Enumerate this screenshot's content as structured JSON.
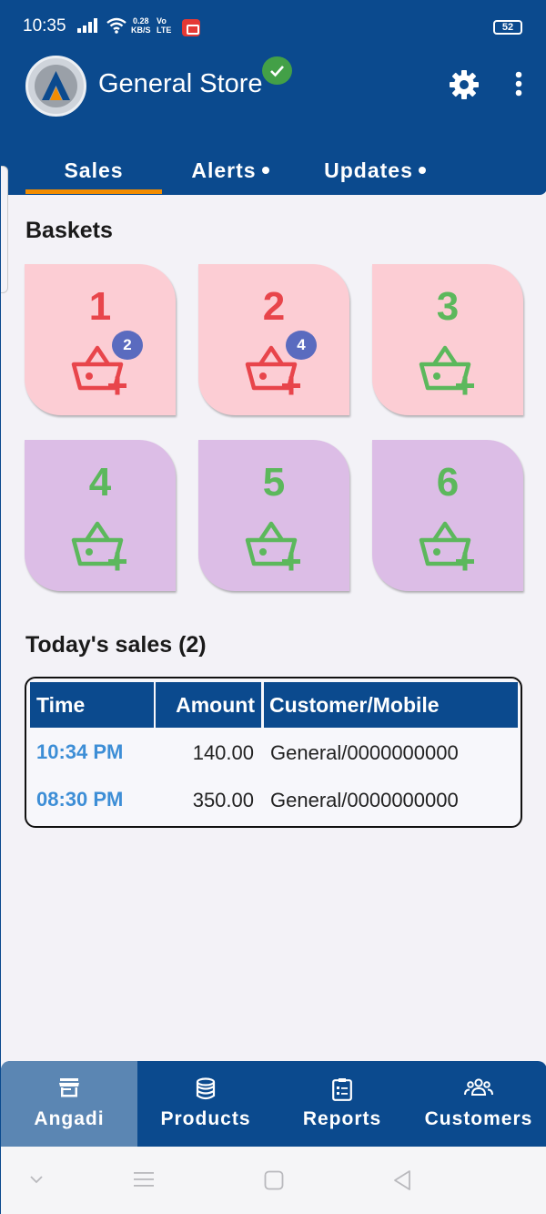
{
  "status": {
    "time": "10:35",
    "net_speed_value": "0.28",
    "net_speed_unit": "KB/S",
    "volte_top": "Vo",
    "volte_bottom": "LTE",
    "battery": "52"
  },
  "header": {
    "store_name": "General Store"
  },
  "tabs": [
    {
      "label": "Sales",
      "active": true,
      "has_dot": false
    },
    {
      "label": "Alerts",
      "active": false,
      "has_dot": true
    },
    {
      "label": "Updates",
      "active": false,
      "has_dot": true
    }
  ],
  "baskets": {
    "title": "Baskets",
    "items": [
      {
        "number": "1",
        "badge": "2",
        "color": "pink",
        "status": "red"
      },
      {
        "number": "2",
        "badge": "4",
        "color": "pink",
        "status": "red"
      },
      {
        "number": "3",
        "badge": "",
        "color": "pink",
        "status": "green"
      },
      {
        "number": "4",
        "badge": "",
        "color": "lavender",
        "status": "green"
      },
      {
        "number": "5",
        "badge": "",
        "color": "lavender",
        "status": "green"
      },
      {
        "number": "6",
        "badge": "",
        "color": "lavender",
        "status": "green"
      }
    ]
  },
  "sales": {
    "title": "Today's sales (2)",
    "columns": [
      "Time",
      "Amount",
      "Customer/Mobile"
    ],
    "rows": [
      {
        "time": "10:34 PM",
        "amount": "140.00",
        "customer": "General/0000000000"
      },
      {
        "time": "08:30 PM",
        "amount": "350.00",
        "customer": "General/0000000000"
      }
    ]
  },
  "bottom_nav": [
    {
      "label": "Angadi",
      "icon": "store-icon",
      "active": true
    },
    {
      "label": "Products",
      "icon": "database-icon",
      "active": false
    },
    {
      "label": "Reports",
      "icon": "clipboard-icon",
      "active": false
    },
    {
      "label": "Customers",
      "icon": "people-icon",
      "active": false
    }
  ],
  "colors": {
    "primary": "#0b4a8e",
    "accent": "#f28c00",
    "basket_pink": "#fccdd4",
    "basket_lavender": "#dcbde6",
    "status_red": "#e8454b",
    "status_green": "#5cb85c",
    "badge": "#5a6bbf",
    "link_time": "#3d8ed6"
  }
}
